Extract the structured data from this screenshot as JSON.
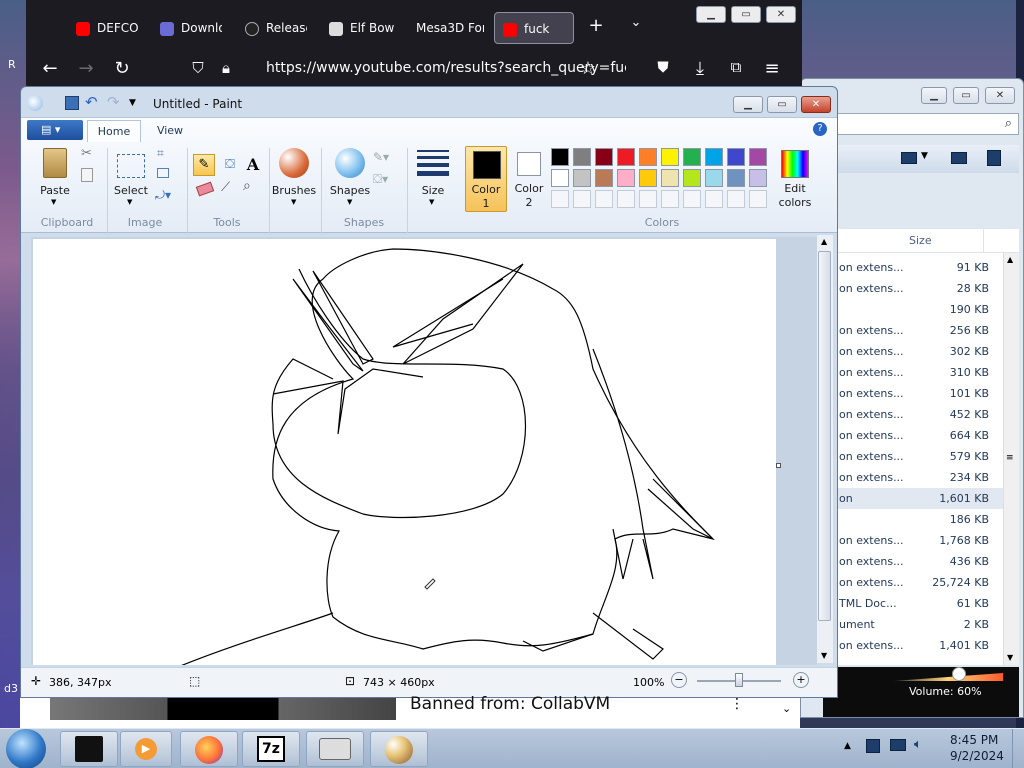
{
  "firefox": {
    "tabs": [
      {
        "label": "DEFCO",
        "icon": "youtube-icon",
        "color": "#ff0000"
      },
      {
        "label": "Downlo",
        "icon": "download-site-icon",
        "color": "#6b6bd6"
      },
      {
        "label": "Release",
        "icon": "github-icon",
        "color": "#222222"
      },
      {
        "label": "Elf Bow",
        "icon": "museum-icon",
        "color": "#dddddd"
      },
      {
        "label": "Mesa3D For",
        "icon": "",
        "color": ""
      },
      {
        "label": "fuck",
        "icon": "youtube-icon",
        "color": "#ff0000"
      }
    ],
    "url": "https://www.youtube.com/results?search_query=fuck"
  },
  "paint": {
    "title": "Untitled - Paint",
    "tabs": [
      "Home",
      "View"
    ],
    "clipboard": {
      "paste": "Paste",
      "label": "Clipboard"
    },
    "image": {
      "select": "Select",
      "label": "Image"
    },
    "tools": {
      "label": "Tools",
      "text_glyph": "A"
    },
    "brushes": {
      "label": "Brushes"
    },
    "shapes": {
      "btn": "Shapes",
      "label": "Shapes"
    },
    "size": {
      "label": "Size"
    },
    "color1": {
      "line1": "Color",
      "line2": "1",
      "value": "#000000"
    },
    "color2": {
      "line1": "Color",
      "line2": "2",
      "value": "#ffffff"
    },
    "colors": {
      "label": "Colors",
      "edit_line1": "Edit",
      "edit_line2": "colors",
      "row1": [
        "#000000",
        "#7f7f7f",
        "#880015",
        "#ed1c24",
        "#ff7f27",
        "#fff200",
        "#22b14c",
        "#00a2e8",
        "#3f48cc",
        "#a349a4"
      ],
      "row2": [
        "#ffffff",
        "#c3c3c3",
        "#b97a57",
        "#ffaec9",
        "#ffc90e",
        "#efe4b0",
        "#b5e61d",
        "#99d9ea",
        "#7092be",
        "#c8bfe7"
      ]
    },
    "status": {
      "cursor_pos": "386, 347px",
      "canvas_size": "743 × 460px",
      "zoom": "100%",
      "zoom_fraction": 0.5
    }
  },
  "explorer": {
    "size_header": "Size",
    "rows": [
      {
        "name": "on extens...",
        "size": "91 KB"
      },
      {
        "name": "on extens...",
        "size": "28 KB"
      },
      {
        "name": "",
        "size": "190 KB"
      },
      {
        "name": "on extens...",
        "size": "256 KB"
      },
      {
        "name": "on extens...",
        "size": "302 KB"
      },
      {
        "name": "on extens...",
        "size": "310 KB"
      },
      {
        "name": "on extens...",
        "size": "101 KB"
      },
      {
        "name": "on extens...",
        "size": "452 KB"
      },
      {
        "name": "on extens...",
        "size": "664 KB"
      },
      {
        "name": "on extens...",
        "size": "579 KB"
      },
      {
        "name": "on extens...",
        "size": "234 KB"
      },
      {
        "name": "on",
        "size": "1,601 KB"
      },
      {
        "name": "",
        "size": "186 KB"
      },
      {
        "name": "on extens...",
        "size": "1,768 KB"
      },
      {
        "name": "on extens...",
        "size": "436 KB"
      },
      {
        "name": "on extens...",
        "size": "25,724 KB"
      },
      {
        "name": "TML Doc...",
        "size": "61 KB"
      },
      {
        "name": "ument",
        "size": "2 KB"
      },
      {
        "name": "on extens...",
        "size": "1,401 KB"
      }
    ],
    "volume": "Volume: 60%",
    "volume_fraction": 0.6
  },
  "youtube": {
    "text": "Banned from: CollabVM"
  },
  "taskbar": {
    "time": "8:45 PM",
    "date": "9/2/2024",
    "apps": [
      "start-orb",
      "media-player",
      "firefox",
      "7zip",
      "network-tool",
      "paint"
    ]
  },
  "desktop": {
    "left_text_1": "R",
    "left_text_2": "d3"
  }
}
